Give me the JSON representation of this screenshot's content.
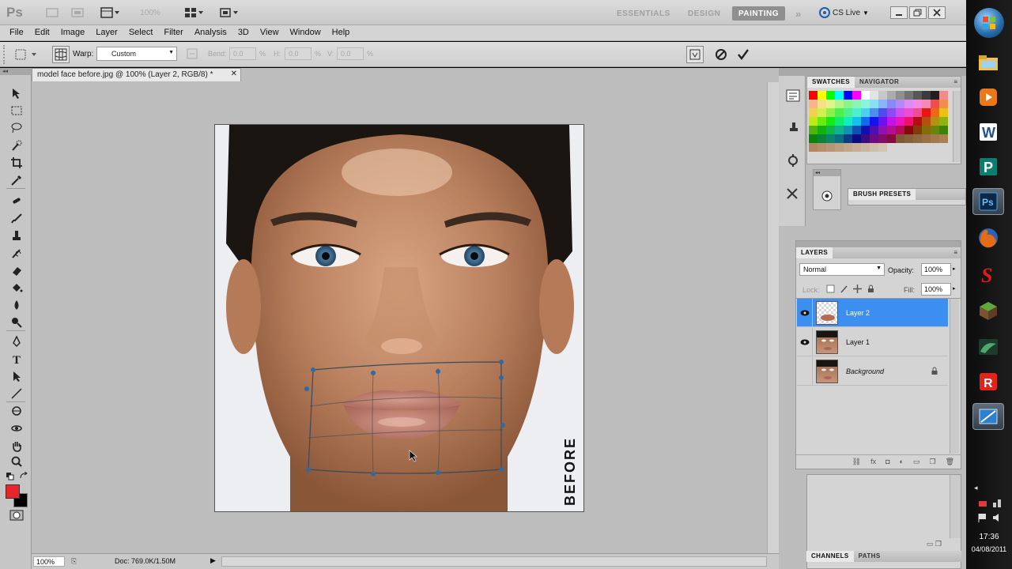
{
  "app": {
    "logo": "Ps",
    "zoom_display": "100%"
  },
  "workspaces": {
    "essentials": "ESSENTIALS",
    "design": "DESIGN",
    "painting": "PAINTING",
    "more": "»",
    "cslive": "CS Live"
  },
  "menu": [
    "File",
    "Edit",
    "Image",
    "Layer",
    "Select",
    "Filter",
    "Analysis",
    "3D",
    "View",
    "Window",
    "Help"
  ],
  "options": {
    "warp_label": "Warp:",
    "warp_value": "Custom",
    "bend_label": "Bend:",
    "bend_value": "0.0",
    "pct": "%",
    "h_label": "H:",
    "h_value": "0.0",
    "v_label": "V:",
    "v_value": "0.0"
  },
  "document": {
    "tab_title": "model face before.jpg @ 100% (Layer 2, RGB/8) *",
    "watermark": "BEFORE"
  },
  "status": {
    "zoom": "100%",
    "doc": "Doc: 769.0K/1.50M"
  },
  "panels": {
    "swatches_tab": "SWATCHES",
    "navigator_tab": "NAVIGATOR",
    "brush_presets": "BRUSH PRESETS",
    "layers_tab": "LAYERS",
    "blend_mode": "Normal",
    "opacity_label": "Opacity:",
    "opacity_value": "100%",
    "lock_label": "Lock:",
    "fill_label": "Fill:",
    "fill_value": "100%",
    "channels_tab": "CHANNELS",
    "paths_tab": "PATHS"
  },
  "layers": [
    {
      "name": "Layer 2",
      "selected": true,
      "visible": true
    },
    {
      "name": "Layer 1",
      "selected": false,
      "visible": true
    },
    {
      "name": "Background",
      "selected": false,
      "visible": false,
      "locked": true
    }
  ],
  "taskbar": {
    "time": "17:36",
    "date": "04/08/2011"
  },
  "colors": {
    "foreground": "#e8262a",
    "background": "#000000",
    "accent_selection": "#3c8ff0"
  }
}
